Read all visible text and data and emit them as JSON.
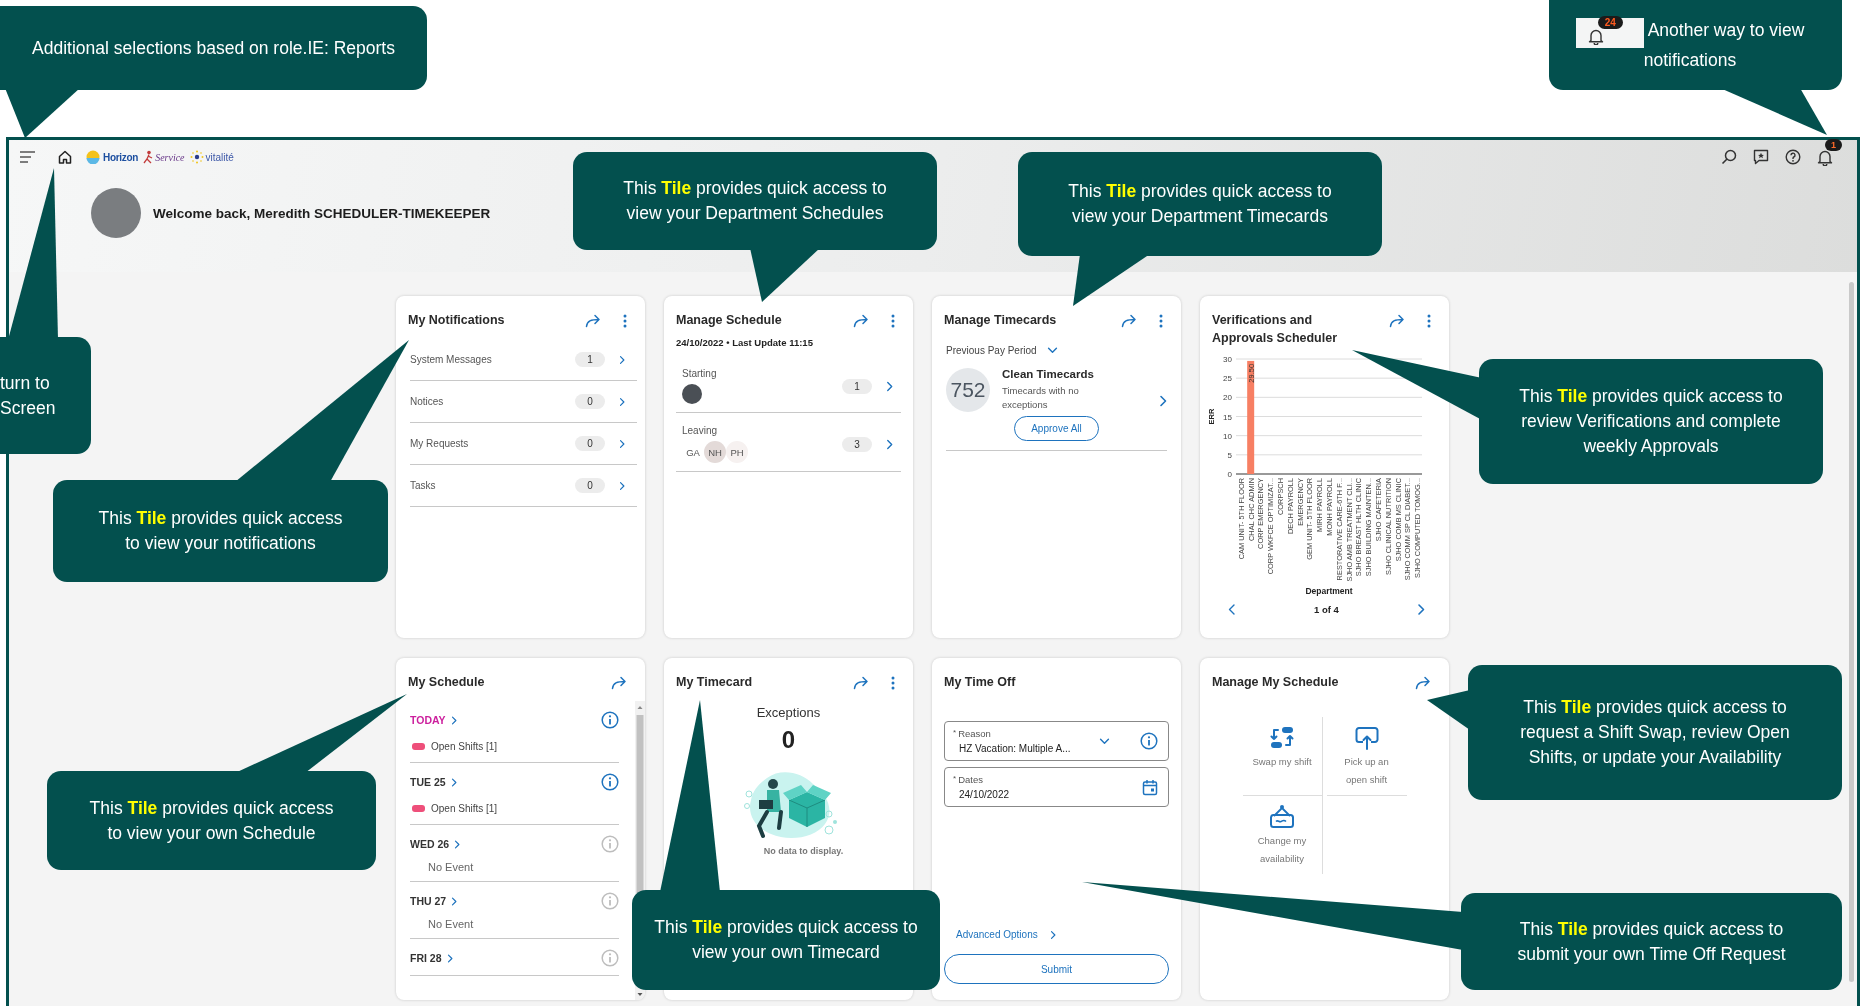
{
  "callouts": [
    {
      "kind": "plain",
      "text": "Additional selections based on role.IE: Reports"
    },
    {
      "kind": "bell",
      "badge": "24",
      "text": "Another way to view notifications"
    },
    {
      "kind": "plain",
      "text": "turn to Screen"
    },
    {
      "kind": "plain",
      "text": "This **Tile** provides quick access to view your Department Schedules"
    },
    {
      "kind": "plain",
      "text": "This **Tile** provides quick access to view your Department Timecards"
    },
    {
      "kind": "plain",
      "text": "This **Tile** provides quick access to view your notifications"
    },
    {
      "kind": "plain",
      "text": "This **Tile** provides quick access to review Verifications and complete weekly Approvals"
    },
    {
      "kind": "plain",
      "text": "This **Tile** provides quick access to view your own Schedule"
    },
    {
      "kind": "plain",
      "text": "This **Tile** provides quick access to view your own Timecard"
    },
    {
      "kind": "plain",
      "text": "This **Tile** provides quick access to request a Shift Swap, review Open Shifts, or update your Availability"
    },
    {
      "kind": "plain",
      "text": "This **Tile** provides quick access to submit your own Time Off Request"
    }
  ],
  "topbar": {
    "logos": [
      "Horizon",
      "Service",
      "vitalité"
    ],
    "notification_badge": "1"
  },
  "welcome": "Welcome back, Meredith SCHEDULER-TIMEKEEPER",
  "tiles": [
    {
      "kind": "notifications",
      "title": "My Notifications",
      "link_arrow": true,
      "menu": true,
      "rows": [
        {
          "label": "System Messages",
          "count": "1"
        },
        {
          "label": "Notices",
          "count": "0"
        },
        {
          "label": "My Requests",
          "count": "0"
        },
        {
          "label": "Tasks",
          "count": "0"
        }
      ]
    },
    {
      "kind": "schedule_summary",
      "title": "Manage Schedule",
      "link_arrow": true,
      "menu": true,
      "subtitle": "24/10/2022 • Last Update 11:15",
      "groups": [
        {
          "label": "Starting",
          "count": "1",
          "people": [
            {
              "kind": "photo"
            }
          ]
        },
        {
          "label": "Leaving",
          "count": "3",
          "people": [
            {
              "kind": "initials",
              "text": "GA",
              "color": "#ffffff"
            },
            {
              "kind": "initials",
              "text": "NH",
              "color": "#e3dad8"
            },
            {
              "kind": "initials",
              "text": "PH",
              "color": "#f6f1f0"
            }
          ]
        }
      ]
    },
    {
      "kind": "timecards",
      "title": "Manage Timecards",
      "link_arrow": true,
      "menu": true,
      "period": "Previous Pay Period",
      "count": "752",
      "heading": "Clean Timecards",
      "description": "Timecards with no exceptions",
      "button": "Approve All"
    },
    {
      "kind": "chart",
      "title": "Verifications and Approvals Scheduler",
      "link_arrow": true,
      "menu": true,
      "pager": "1 of 4",
      "chart_data": {
        "type": "bar",
        "xlabel": "Department",
        "ylabel": "ERR",
        "categories": [
          "CAM UNIT- 5TH FLOOR",
          "CHAL CHC ADMIN",
          "CORP EMERGENCY",
          "CORP WKFCE OPTIMIZAT...",
          "CORPSCH",
          "DECH PAYROLL",
          "EMERGENCY",
          "GEM UNIT- 5TH FLOOR",
          "MIRH PAYROLL",
          "MONH PAYROLL",
          "RESTORATIVE CARE-6TH F...",
          "SJHO AMB TREATMENT CLI...",
          "SJHO BREAST HLTH CLINIC",
          "SJHO BUILDING MAINTEN...",
          "SJHO CAFETERIA",
          "SJHO CLINICAL NUTRITION",
          "SJHO COMB MS CLINIC",
          "SJHO COMM SP CL DIABET...",
          "SJHO COMPUTED TOMOG..."
        ],
        "series": [
          {
            "color": "#f77f63",
            "values": [
              0,
              29.5,
              0,
              0,
              0,
              0,
              0,
              0,
              0,
              0,
              0,
              0,
              0,
              0,
              0,
              0,
              0,
              0,
              0
            ]
          }
        ],
        "value_labels": [
          null,
          "29.50",
          null,
          null,
          null,
          null,
          null,
          null,
          null,
          null,
          null,
          null,
          null,
          null,
          null,
          null,
          null,
          null,
          null
        ],
        "ylim": [
          0,
          30
        ],
        "yticks": [
          0,
          5,
          10,
          15,
          20,
          25,
          30
        ],
        "grid": true
      }
    },
    {
      "kind": "my_schedule",
      "title": "My Schedule",
      "link_arrow": true,
      "menu": false,
      "days": [
        {
          "label": "TODAY",
          "today": true,
          "events": [
            {
              "text": "Open Shifts [1]",
              "color": "#ee4f7a"
            }
          ]
        },
        {
          "label": "TUE 25",
          "today": false,
          "events": [
            {
              "text": "Open Shifts [1]",
              "color": "#ee4f7a"
            }
          ]
        },
        {
          "label": "WED 26",
          "today": false,
          "note": "No Event"
        },
        {
          "label": "THU 27",
          "today": false,
          "note": "No Event"
        },
        {
          "label": "FRI 28",
          "today": false
        }
      ]
    },
    {
      "kind": "my_timecard",
      "title": "My Timecard",
      "link_arrow": true,
      "menu": true,
      "label": "Exceptions",
      "value": "0",
      "empty_text": "No data to display."
    },
    {
      "kind": "time_off",
      "title": "My Time Off",
      "link_arrow": false,
      "menu": false,
      "fields": [
        {
          "kind": "select",
          "required_mark": "*",
          "label": "Reason",
          "value": "HZ Vacation: Multiple A..."
        },
        {
          "kind": "date",
          "required_mark": "*",
          "label": "Dates",
          "value": "24/10/2022"
        }
      ],
      "link": "Advanced Options",
      "button": "Submit"
    },
    {
      "kind": "actions",
      "title": "Manage My Schedule",
      "link_arrow": true,
      "menu": false,
      "actions": [
        {
          "kind": "swap",
          "label": "Swap my shift"
        },
        {
          "kind": "pickup",
          "label": "Pick up an open shift"
        },
        {
          "kind": "availability",
          "label": "Change my availability"
        }
      ]
    }
  ]
}
